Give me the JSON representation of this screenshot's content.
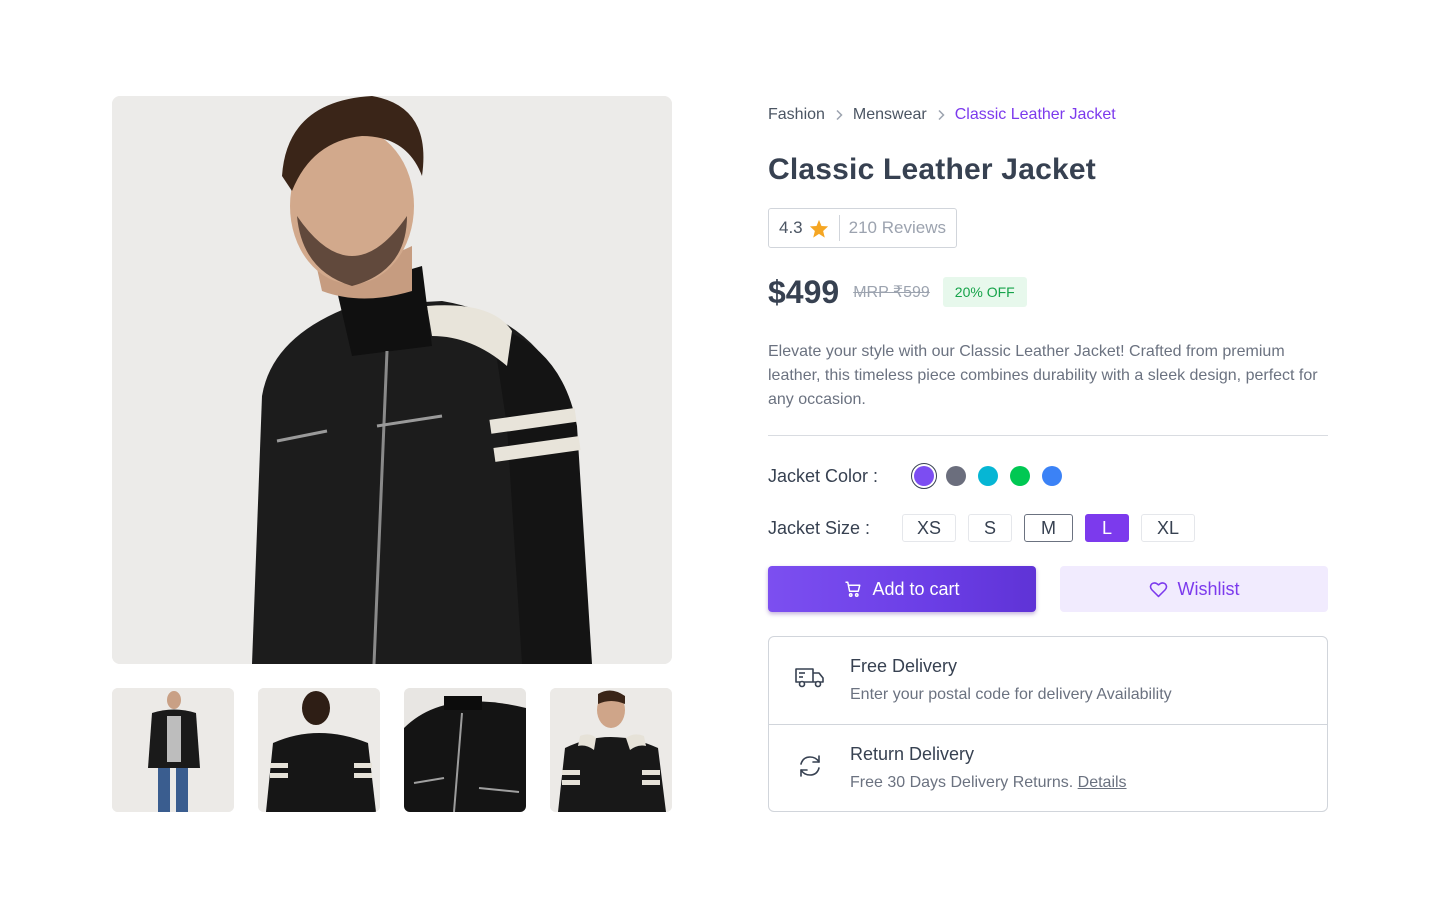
{
  "breadcrumb": {
    "items": [
      "Fashion",
      "Menswear"
    ],
    "current": "Classic Leather Jacket"
  },
  "product": {
    "title": "Classic Leather Jacket",
    "rating": "4.3",
    "reviews": "210 Reviews",
    "price": "$499",
    "mrp": "MRP ₹599",
    "discount": "20% OFF",
    "description": "Elevate your style with our Classic Leather Jacket! Crafted from premium leather, this timeless piece combines durability with a sleek design, perfect for any occasion."
  },
  "options": {
    "color_label": "Jacket Color :",
    "colors": [
      "#7c4df2",
      "#6b6e7d",
      "#06b6d4",
      "#00c853",
      "#3b82f6"
    ],
    "selected_color": "#7c4df2",
    "size_label": "Jacket Size :",
    "sizes": [
      "XS",
      "S",
      "M",
      "L",
      "XL"
    ],
    "selected_size": "L"
  },
  "actions": {
    "cart_label": "Add to cart",
    "wishlist_label": "Wishlist"
  },
  "delivery": {
    "free_title": "Free Delivery",
    "free_sub": "Enter your postal code for delivery Availability",
    "return_title": "Return Delivery",
    "return_sub": "Free 30 Days Delivery Returns.",
    "return_link": "Details"
  },
  "theme": {
    "accent": "#7c3aed",
    "star": "#f5a623",
    "success": "#16a34a"
  }
}
